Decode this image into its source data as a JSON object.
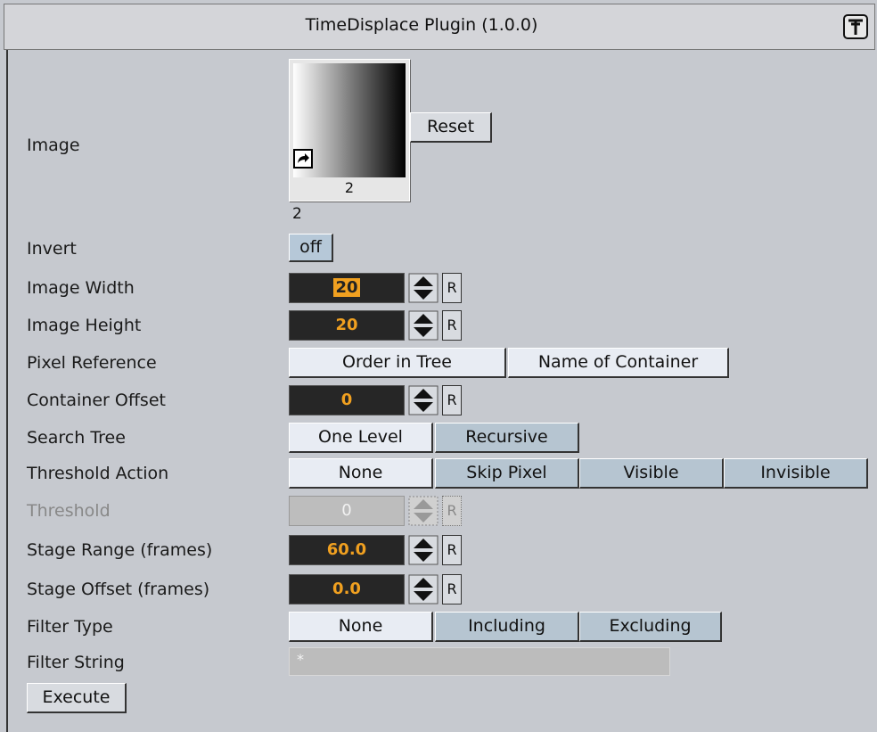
{
  "title": "TimeDisplace Plugin (1.0.0)",
  "icons": {
    "title": "plugin-icon",
    "image_link": "link-arrow-icon",
    "spinner": "up-down-spinner-icon"
  },
  "image": {
    "label": "Image",
    "thumb_number": "2",
    "below_number": "2",
    "reset": "Reset"
  },
  "invert": {
    "label": "Invert",
    "value": "off"
  },
  "image_width": {
    "label": "Image Width",
    "value": "20",
    "reset": "R"
  },
  "image_height": {
    "label": "Image Height",
    "value": "20",
    "reset": "R"
  },
  "pixel_reference": {
    "label": "Pixel Reference",
    "options": [
      "Order in Tree",
      "Name of Container"
    ]
  },
  "container_offset": {
    "label": "Container Offset",
    "value": "0",
    "reset": "R"
  },
  "search_tree": {
    "label": "Search Tree",
    "options": [
      "One Level",
      "Recursive"
    ]
  },
  "threshold_action": {
    "label": "Threshold Action",
    "options": [
      "None",
      "Skip Pixel",
      "Visible",
      "Invisible"
    ]
  },
  "threshold": {
    "label": "Threshold",
    "value": "0",
    "reset": "R"
  },
  "stage_range": {
    "label": "Stage Range (frames)",
    "value": "60.0",
    "reset": "R"
  },
  "stage_offset": {
    "label": "Stage Offset (frames)",
    "value": "0.0",
    "reset": "R"
  },
  "filter_type": {
    "label": "Filter Type",
    "options": [
      "None",
      "Including",
      "Excluding"
    ]
  },
  "filter_string": {
    "label": "Filter String",
    "value": "*"
  },
  "execute": "Execute",
  "colors": {
    "panel": "#c6c9cf",
    "field_bg": "#262626",
    "field_text": "#f0a020",
    "selected_option": "#e8ecf3",
    "option": "#b6c5d1"
  }
}
